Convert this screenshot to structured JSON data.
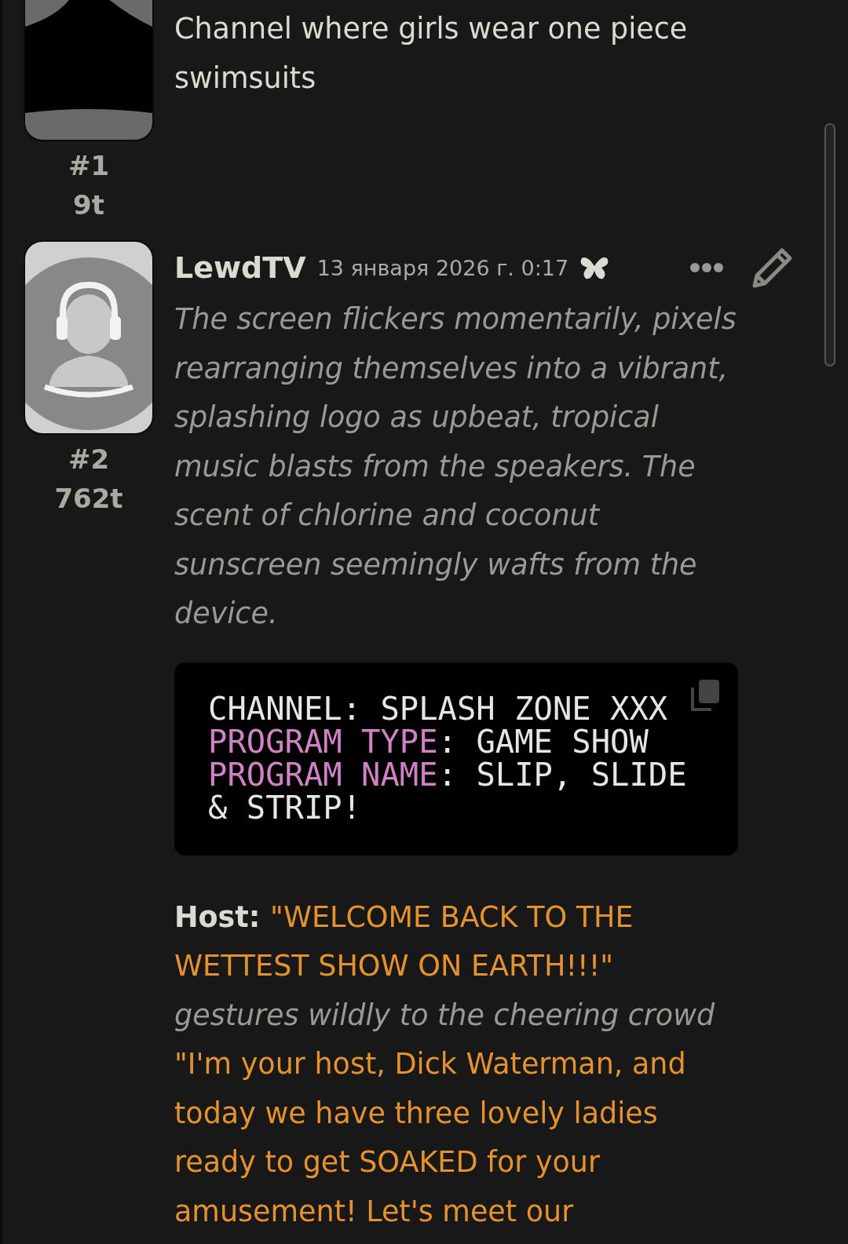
{
  "messages": [
    {
      "kind": "mystery",
      "index": "#1",
      "tokens": "9t",
      "paragraphs": [
        {
          "segments": [
            {
              "kind": "plain",
              "text": "Channel where girls wear one piece swimsuits"
            }
          ]
        }
      ]
    },
    {
      "kind": "user",
      "index": "#2",
      "tokens": "762t",
      "name": "LewdTV",
      "date": "13 января 2026 г. 0:17",
      "paragraphs": [
        {
          "segments": [
            {
              "kind": "action",
              "text": "The screen flickers momentarily, pixels rearranging themselves into a vibrant, splashing logo as upbeat, tropical music blasts from the speakers. The scent of chlorine and coconut sunscreen seemingly wafts from the device."
            }
          ]
        },
        {
          "code": [
            [
              {
                "kind": "value",
                "text": "CHANNEL: SPLASH ZONE XXX"
              }
            ],
            [
              {
                "kind": "key",
                "text": "PROGRAM TYPE"
              },
              {
                "kind": "value",
                "text": ": GAME SHOW"
              }
            ],
            [
              {
                "kind": "key",
                "text": "PROGRAM NAME"
              },
              {
                "kind": "value",
                "text": ": SLIP, SLIDE & STRIP!"
              }
            ]
          ]
        },
        {
          "segments": [
            {
              "kind": "bold",
              "text": "Host: "
            },
            {
              "kind": "quote",
              "text": "\"WELCOME BACK TO THE WETTEST SHOW ON EARTH!!!\" "
            },
            {
              "kind": "action",
              "text": "gestures wildly to the cheering crowd "
            },
            {
              "kind": "quote",
              "text": "\"I'm your host, Dick Waterman, and today we have three lovely ladies ready to get SOAKED for your amusement! Let's meet our"
            }
          ]
        }
      ]
    }
  ]
}
